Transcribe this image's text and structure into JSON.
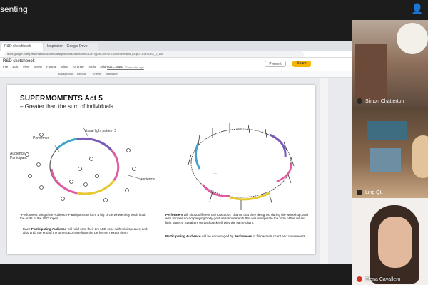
{
  "meeting": {
    "presenting_label": "senting"
  },
  "browser": {
    "tabs": [
      "R&D sketchbook",
      "Inspiration - Google Drive"
    ],
    "url": "docs.google.com/presentation/d/1xeIo4ktwpJsNBxs2l8iDNrohL0LcR7gpuC3v0SXX39NsnBvM8x6_id.gB7OGEXUnZ_0_100"
  },
  "doc": {
    "title": "R&D sketchbook",
    "menus": [
      "File",
      "Edit",
      "View",
      "Insert",
      "Format",
      "Slide",
      "Arrange",
      "Tools",
      "Add-ons",
      "Help"
    ],
    "last_edit": "Last edit was 37 minutes ago",
    "present_label": "Present",
    "share_label": "Share",
    "toolbar": {
      "background": "Background",
      "layout": "Layout",
      "theme": "Theme",
      "transition": "Transition"
    }
  },
  "slide": {
    "title": "SUPERMOMENTS Act 5",
    "subtitle": "– Greater than the sum of individuals",
    "labels": {
      "performer": "Performer",
      "visual_light": "Visual light pattern 5",
      "audience_participant": "Audience\nParticipant",
      "audience": "Audience"
    },
    "left_text_1": "*Performers bring their Audience Participants to form a big circle where they each hold the ends of the LED ropes.",
    "left_text_2_bold": "Participating Audience",
    "left_text_2_pre": "Each ",
    "left_text_2": " will hold onto their 1m LED rope with mini speaker, and also grab the end of the other LED rope from the performer next to them.",
    "right_text_1_bold": "Performers",
    "right_text_1": " will shout different call to actions 'chants' that they designed during the workshop, and with various accompanying body gestures/movements that will manipulate the form of the visual light pattern. Speakers on backpack will play the same chant.",
    "right_text_2_bold": "Participating Audience",
    "right_text_2_mid": " will be encouraged by ",
    "right_text_2_bold2": "Performers",
    "right_text_2": " to follow their chant and movements."
  },
  "participants": [
    {
      "name": "Simon Chatterton"
    },
    {
      "name": "Ling QL"
    },
    {
      "name": "Elena Cavallero"
    }
  ],
  "colors": {
    "share": "#f5b400",
    "rope_pink": "#e05aa0",
    "rope_blue": "#3fa6c9",
    "rope_yellow": "#e6c832",
    "rope_purple": "#7a5ab8"
  }
}
